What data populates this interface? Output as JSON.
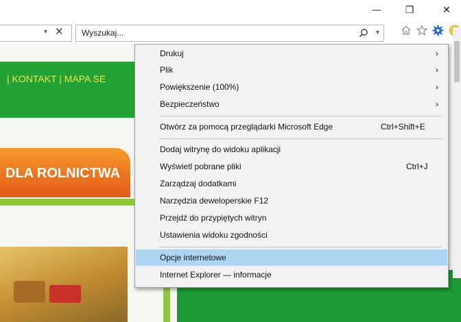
{
  "window": {
    "min_glyph": "—",
    "restore_glyph": "❐",
    "close_glyph": "✕"
  },
  "address": {
    "dropdown_glyph": "▾",
    "clear_glyph": "✕"
  },
  "search": {
    "placeholder": "Wyszukaj...",
    "dropdown_glyph": "▾"
  },
  "page": {
    "nav_text": "| KONTAKT | MAPA SE",
    "banner_text": "DLA ROLNICTWA"
  },
  "menu": {
    "items": [
      {
        "label": "Drukuj",
        "arrow": "›",
        "shortcut": ""
      },
      {
        "label": "Plik",
        "arrow": "›",
        "shortcut": ""
      },
      {
        "label": "Powiększenie (100%)",
        "arrow": "›",
        "shortcut": ""
      },
      {
        "label": "Bezpieczeństwo",
        "arrow": "›",
        "shortcut": ""
      },
      {
        "label": "Otwórz za pomocą przeglądarki Microsoft Edge",
        "arrow": "",
        "shortcut": "Ctrl+Shift+E"
      },
      {
        "label": "Dodaj witrynę do widoku aplikacji",
        "arrow": "",
        "shortcut": ""
      },
      {
        "label": "Wyświetl pobrane pliki",
        "arrow": "",
        "shortcut": "Ctrl+J"
      },
      {
        "label": "Zarządzaj dodatkami",
        "arrow": "",
        "shortcut": ""
      },
      {
        "label": "Narzędzia deweloperskie F12",
        "arrow": "",
        "shortcut": ""
      },
      {
        "label": "Przejdź do przypiętych witryn",
        "arrow": "",
        "shortcut": ""
      },
      {
        "label": "Ustawienia widoku zgodności",
        "arrow": "",
        "shortcut": ""
      },
      {
        "label": "Opcje internetowe",
        "arrow": "",
        "shortcut": ""
      },
      {
        "label": "Internet Explorer — informacje",
        "arrow": "",
        "shortcut": ""
      }
    ]
  },
  "colors": {
    "highlight": "#add6f3",
    "site_green": "#23a236",
    "site_lime": "#8fc93a",
    "nav_yellow": "#f0e24a",
    "banner_orange": "#e25a16",
    "gear_blue": "#1f6fb5",
    "smiley_yellow": "#f6cf3b"
  }
}
